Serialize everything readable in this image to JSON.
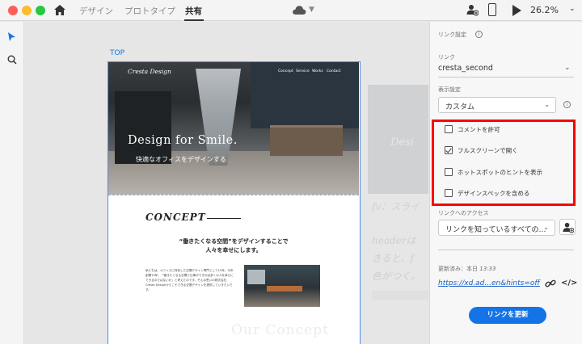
{
  "titlebar": {
    "tabs": [
      {
        "label": "デザイン",
        "active": false
      },
      {
        "label": "プロトタイプ",
        "active": false
      },
      {
        "label": "共有",
        "active": true
      }
    ],
    "zoom": "26.2%"
  },
  "canvas": {
    "artboard_label": "TOP",
    "hero": {
      "logo": "Cresta Design",
      "nav": [
        "Concept",
        "Service",
        "Works",
        "Contact"
      ],
      "title": "Design for Smile.",
      "subtitle": "快適なオフィスをデザインする"
    },
    "concept": {
      "title": "CONCEPT",
      "lead_line1": "“働きたくなる空間”をデザインすることで",
      "lead_line2": "人々を幸せにします。",
      "body": "私たちは、オフィスに特化した空間デザイン専門として10年。今年創業10年、「働きたくなる空間で仕事ができれば多くの人を幸せにできるのではないか」と考えたのです。そんな思いの株式会社Cresta Designからこそできる空間デザインを提供していきたいです。",
      "ghost": "Our Concept"
    },
    "faded": {
      "text1": "Desi",
      "text2": "fv：スライ",
      "text3": "headerは",
      "text4": "きると、f",
      "text5": "色がつく。"
    }
  },
  "panel": {
    "link_settings_label": "リンク設定",
    "link_label": "リンク",
    "link_value": "cresta_second",
    "display_label": "表示設定",
    "display_value": "カスタム",
    "options": [
      {
        "label": "コメントを許可",
        "checked": false
      },
      {
        "label": "フルスクリーンで開く",
        "checked": true
      },
      {
        "label": "ホットスポットのヒントを表示",
        "checked": false
      },
      {
        "label": "デザインスペックを含める",
        "checked": false
      }
    ],
    "access_label": "リンクへのアクセス",
    "access_value": "リンクを知っているすべての…",
    "updated_prefix": "更新済み：本日",
    "updated_time": "13:33",
    "share_url": "https://xd.ad...en&hints=off",
    "update_button": "リンクを更新"
  },
  "colors": {
    "accent": "#1473e6",
    "highlight": "#ff0000"
  }
}
